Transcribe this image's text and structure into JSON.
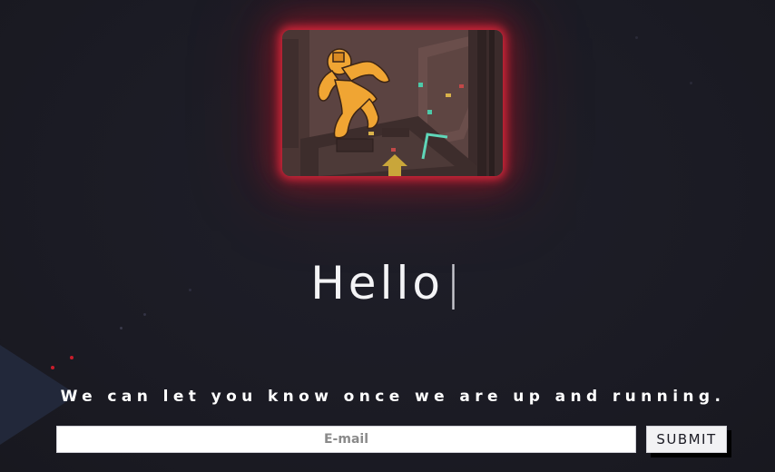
{
  "hero": {
    "image_description_icon": "astronaut-illustration-icon",
    "glow_color": "#e6283c"
  },
  "headline": {
    "text": "Hello",
    "caret": "|"
  },
  "signup": {
    "tagline": "We can let you know once we are up and running.",
    "email_placeholder": "E-mail",
    "submit_label": "SUBMIT"
  },
  "colors": {
    "background": "#1b1b24",
    "accent_dot": "#d11f2e",
    "text": "#ffffff"
  }
}
